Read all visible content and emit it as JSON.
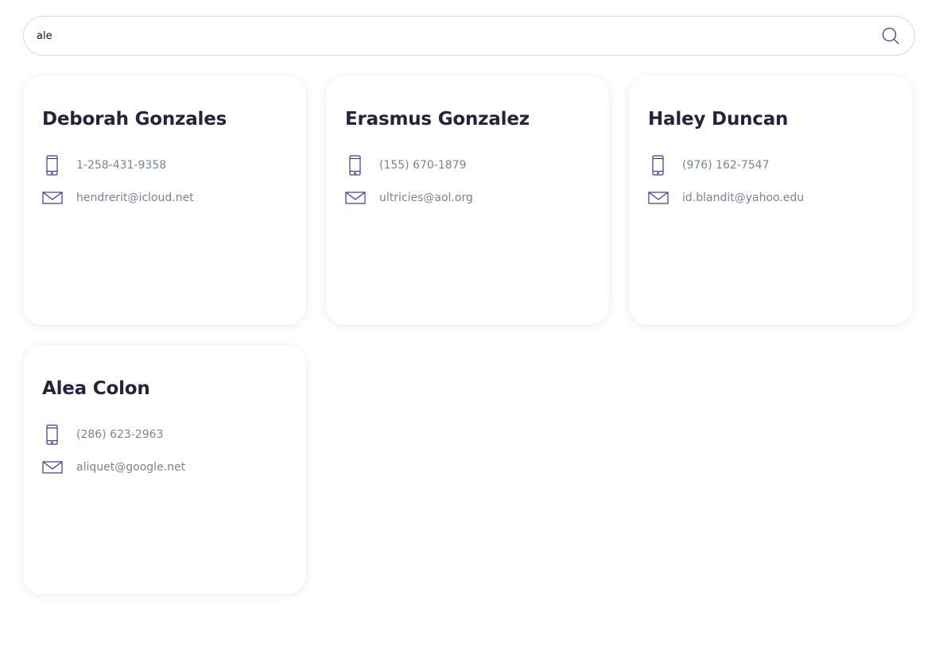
{
  "search": {
    "value": "ale",
    "icon": "search-icon"
  },
  "colors": {
    "accent": "#3d3a8c",
    "name": "#24253a",
    "detail": "#7a8296",
    "border": "#d9d6ef"
  },
  "contacts": [
    {
      "name": "Deborah Gonzales",
      "phone": "1-258-431-9358",
      "email": "hendrerit@icloud.net"
    },
    {
      "name": "Erasmus Gonzalez",
      "phone": "(155) 670-1879",
      "email": "ultricies@aol.org"
    },
    {
      "name": "Haley Duncan",
      "phone": "(976) 162-7547",
      "email": "id.blandit@yahoo.edu"
    },
    {
      "name": "Alea Colon",
      "phone": "(286) 623-2963",
      "email": "aliquet@google.net"
    }
  ]
}
